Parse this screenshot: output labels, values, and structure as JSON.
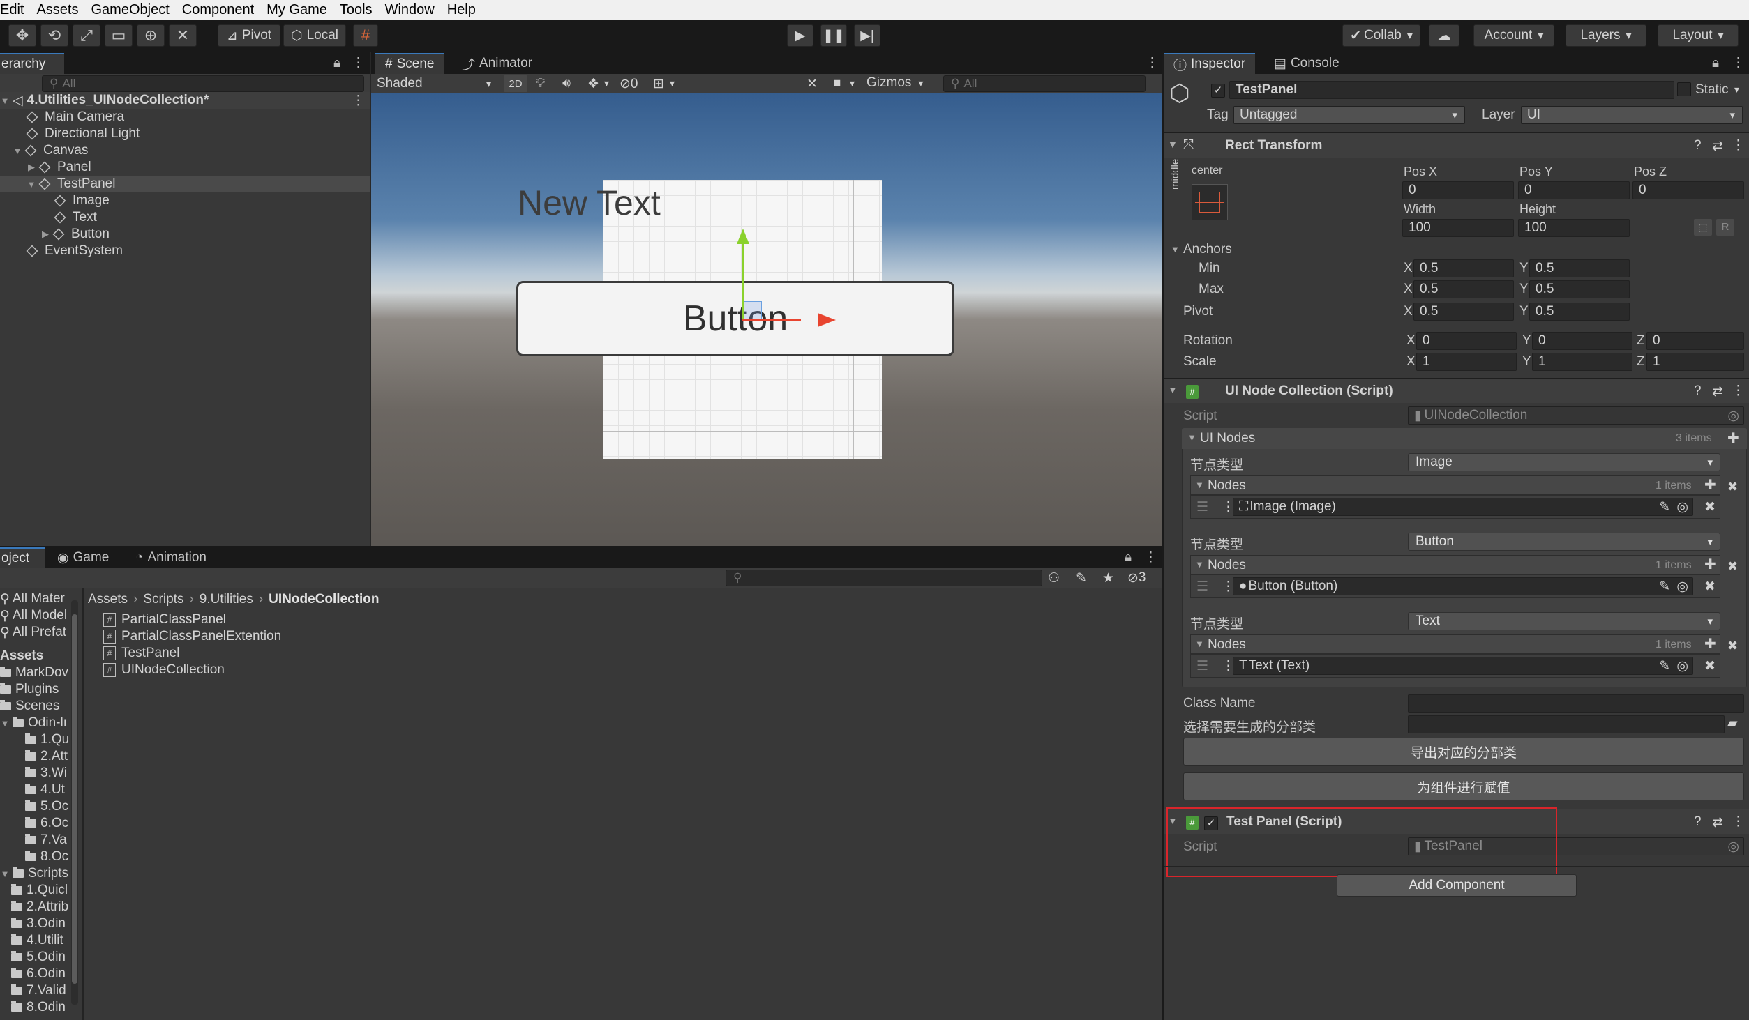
{
  "menu": [
    "Edit",
    "Assets",
    "GameObject",
    "Component",
    "My Game",
    "Tools",
    "Window",
    "Help"
  ],
  "toolbar": {
    "pivot": "Pivot",
    "local": "Local",
    "collab": "Collab",
    "account": "Account",
    "layers": "Layers",
    "layout": "Layout"
  },
  "hierarchy": {
    "tab": "erarchy",
    "search_placeholder": "All",
    "scene": "4.Utilities_UINodeCollection*",
    "items": [
      "Main Camera",
      "Directional Light",
      "Canvas",
      "Panel",
      "TestPanel",
      "Image",
      "Text",
      "Button",
      "EventSystem"
    ]
  },
  "scene_view": {
    "tabs": [
      "Scene",
      "Animator"
    ],
    "shading": "Shaded",
    "mode_2d": "2D",
    "hidden_count": "0",
    "gizmos": "Gizmos",
    "search_placeholder": "All",
    "new_text": "New Text",
    "button_text": "Button"
  },
  "bottom_tabs": [
    "oject",
    "Game",
    "Animation"
  ],
  "project": {
    "hidden_count": "3",
    "favorites": [
      "All Mater",
      "All Model",
      "All Prefat"
    ],
    "assets_label": "Assets",
    "tree": [
      "MarkDov",
      "Plugins",
      "Scenes",
      "Odin-lı",
      "1.Qu",
      "2.Att",
      "3.Wi",
      "4.Ut",
      "5.Oc",
      "6.Oc",
      "7.Va",
      "8.Oc",
      "Scripts",
      "1.Quicl",
      "2.Attrib",
      "3.Odin",
      "4.Utilit",
      "5.Odin",
      "6.Odin",
      "7.Valid",
      "8.Odin"
    ],
    "breadcrumb": [
      "Assets",
      "Scripts",
      "9.Utilities",
      "UINodeCollection"
    ],
    "files": [
      "PartialClassPanel",
      "PartialClassPanelExtention",
      "TestPanel",
      "UINodeCollection"
    ]
  },
  "inspector": {
    "tabs": [
      "Inspector",
      "Console"
    ],
    "object_name": "TestPanel",
    "static_label": "Static",
    "tag_label": "Tag",
    "tag_value": "Untagged",
    "layer_label": "Layer",
    "layer_value": "UI",
    "rect_transform": {
      "title": "Rect Transform",
      "anchor_h": "center",
      "anchor_v": "middle",
      "pos_x_label": "Pos X",
      "pos_y_label": "Pos Y",
      "pos_z_label": "Pos Z",
      "pos_x": "0",
      "pos_y": "0",
      "pos_z": "0",
      "width_label": "Width",
      "height_label": "Height",
      "width": "100",
      "height": "100",
      "r_label": "R",
      "anchors_label": "Anchors",
      "min_label": "Min",
      "max_label": "Max",
      "min_x": "0.5",
      "min_y": "0.5",
      "max_x": "0.5",
      "max_y": "0.5",
      "pivot_label": "Pivot",
      "pivot_x": "0.5",
      "pivot_y": "0.5",
      "rotation_label": "Rotation",
      "rot_x": "0",
      "rot_y": "0",
      "rot_z": "0",
      "scale_label": "Scale",
      "scale_x": "1",
      "scale_y": "1",
      "scale_z": "1",
      "x": "X",
      "y": "Y",
      "z": "Z"
    },
    "ui_node_collection": {
      "title": "UI Node Collection (Script)",
      "script_label": "Script",
      "script_value": "UINodeCollection",
      "ui_nodes_label": "UI Nodes",
      "ui_nodes_count": "3 items",
      "groups": [
        {
          "type_label": "节点类型",
          "type": "Image",
          "nodes_label": "Nodes",
          "count": "1 items",
          "item": "Image (Image)"
        },
        {
          "type_label": "节点类型",
          "type": "Button",
          "nodes_label": "Nodes",
          "count": "1 items",
          "item": "Button (Button)"
        },
        {
          "type_label": "节点类型",
          "type": "Text",
          "nodes_label": "Nodes",
          "count": "1 items",
          "item": "Text (Text)"
        }
      ],
      "class_name_label": "Class Name",
      "select_partial_label": "选择需要生成的分部类",
      "export_button": "导出对应的分部类",
      "assign_button": "为组件进行赋值"
    },
    "test_panel": {
      "title": "Test Panel (Script)",
      "script_label": "Script",
      "script_value": "TestPanel"
    },
    "add_component": "Add Component"
  },
  "colors": {
    "highlight_box": "#d9252b",
    "selection": "#2c5d87",
    "x_axis": "#e8442f",
    "y_axis": "#8ad12c"
  }
}
